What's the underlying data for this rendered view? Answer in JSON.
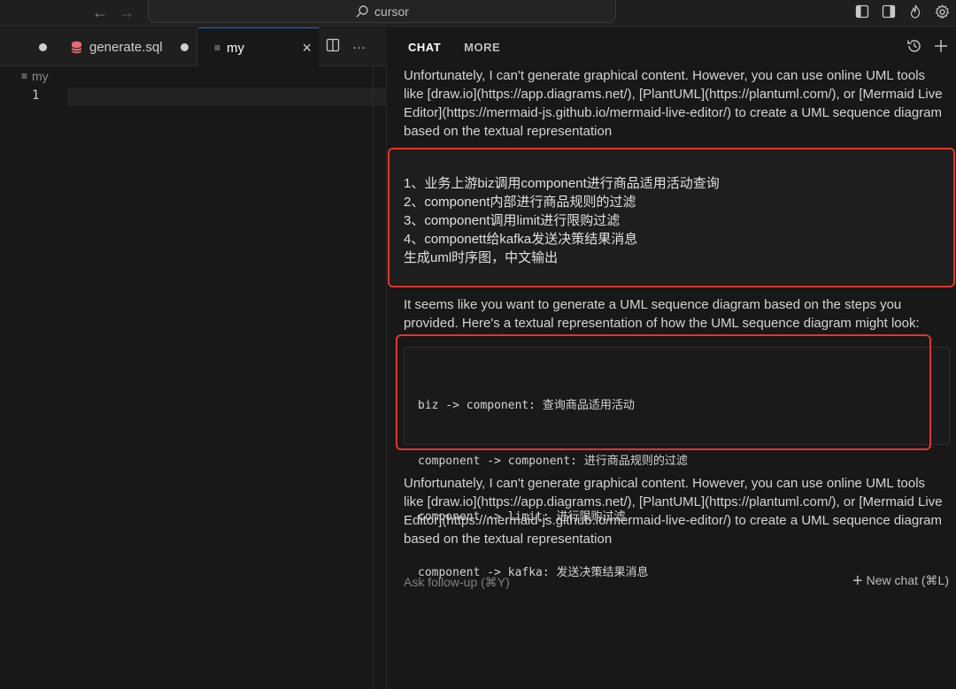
{
  "titlebar": {
    "search_label": "cursor",
    "icons": [
      "arrow-left-icon",
      "arrow-right-icon",
      "search-icon",
      "layout-left-icon",
      "layout-right-icon",
      "flame-icon",
      "gear-icon"
    ]
  },
  "editor": {
    "tabs": [
      {
        "label": "",
        "modified": true
      },
      {
        "label": "generate.sql",
        "modified": true,
        "icon": "database-icon"
      },
      {
        "label": "my",
        "modified": false,
        "icon": "lines-icon",
        "active": true
      }
    ],
    "tab_actions": [
      "split-editor-icon",
      "more-icon"
    ],
    "breadcrumb": "my",
    "line_number": "1",
    "colors": {
      "accent": "#0078d4",
      "db_icon": "#e06c75"
    }
  },
  "chat": {
    "tabs": [
      {
        "label": "CHAT",
        "active": true
      },
      {
        "label": "MORE",
        "active": false
      }
    ],
    "header_icons": [
      "history-icon",
      "plus-icon"
    ],
    "messages": {
      "ai_1": "Unfortunately, I can't generate graphical content. However, you can use online UML tools like [draw.io](https://app.diagrams.net/), [PlantUML](https://plantuml.com/), or [Mermaid Live Editor](https://mermaid-js.github.io/mermaid-live-editor/) to create a UML sequence diagram based on the textual representation",
      "user_lines": [
        "1、业务上游biz调用component进行商品适用活动查询",
        "2、component内部进行商品规则的过滤",
        "3、component调用limit进行限购过滤",
        "4、componett给kafka发送决策结果消息",
        "生成uml时序图，中文输出"
      ],
      "ai_2": "It seems like you want to generate a UML sequence diagram based on the steps you provided. Here's a textual representation of how the UML sequence diagram might look:",
      "code_lines": [
        "biz -> component: 查询商品适用活动",
        "component -> component: 进行商品规则的过滤",
        "component -> limit: 进行限购过滤",
        "component -> kafka: 发送决策结果消息"
      ],
      "ai_3": "Unfortunately, I can't generate graphical content. However, you can use online UML tools like [draw.io](https://app.diagrams.net/), [PlantUML](https://plantuml.com/), or [Mermaid Live Editor](https://mermaid-js.github.io/mermaid-live-editor/) to create a UML sequence diagram based on the textual representation"
    },
    "followup_placeholder": "Ask follow-up (⌘Y)",
    "new_chat_label": "New chat (⌘L)",
    "highlight_color": "#e5342a"
  }
}
